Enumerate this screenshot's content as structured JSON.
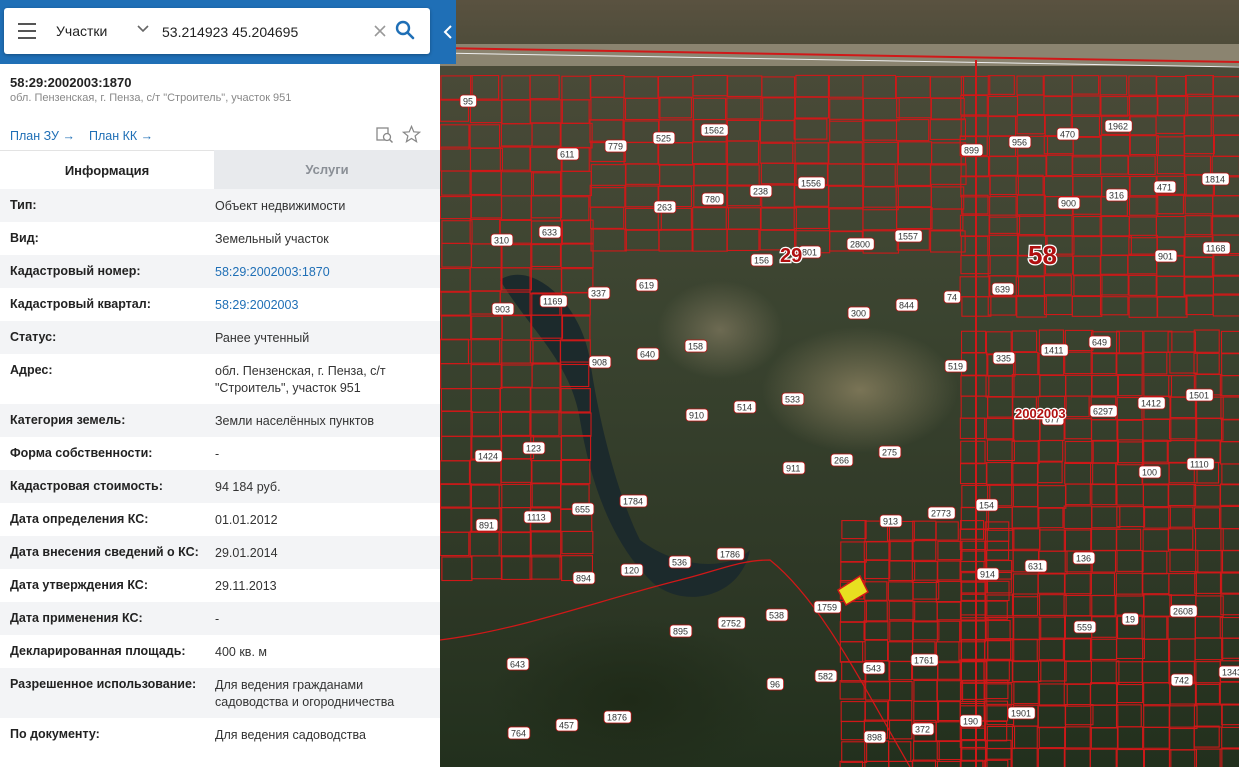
{
  "search": {
    "layer": "Участки",
    "query": "53.214923 45.204695"
  },
  "parcel": {
    "title": "58:29:2002003:1870",
    "address": "обл. Пензенская, г. Пенза, с/т \"Строитель\", участок 951"
  },
  "links": {
    "plan_zu": "План ЗУ",
    "plan_kk": "План КК"
  },
  "tabs": {
    "info": "Информация",
    "services": "Услуги"
  },
  "info": [
    {
      "key": "Тип:",
      "value": "Объект недвижимости"
    },
    {
      "key": "Вид:",
      "value": "Земельный участок"
    },
    {
      "key": "Кадастровый номер:",
      "value": "58:29:2002003:1870"
    },
    {
      "key": "Кадастровый квартал:",
      "value": "58:29:2002003"
    },
    {
      "key": "Статус:",
      "value": "Ранее учтенный"
    },
    {
      "key": "Адрес:",
      "value": "обл. Пензенская, г. Пенза, с/т \"Строитель\", участок 951"
    },
    {
      "key": "Категория земель:",
      "value": "Земли населённых пунктов"
    },
    {
      "key": "Форма собственности:",
      "value": "-"
    },
    {
      "key": "Кадастровая стоимость:",
      "value": "94 184 руб."
    },
    {
      "key": "Дата определения КС:",
      "value": "01.01.2012"
    },
    {
      "key": "Дата внесения сведений о КС:",
      "value": "29.01.2014"
    },
    {
      "key": "Дата утверждения КС:",
      "value": "29.11.2013"
    },
    {
      "key": "Дата применения КС:",
      "value": "-"
    },
    {
      "key": "Декларированная площадь:",
      "value": "400 кв. м"
    },
    {
      "key": "Разрешенное использование:",
      "value": "Для ведения гражданами садоводства и огородничества"
    },
    {
      "key": "По документу:",
      "value": "Для ведения садоводства"
    }
  ],
  "map": {
    "quarter_labels": [
      "29",
      "58",
      "2002003"
    ],
    "plot_labels": [
      "95",
      "611",
      "263",
      "156",
      "300",
      "519",
      "677",
      "100",
      "891",
      "894",
      "895",
      "96",
      "898",
      "899",
      "900",
      "901",
      "903",
      "908",
      "910",
      "911",
      "913",
      "914",
      "559",
      "742",
      "764",
      "779",
      "780",
      "801",
      "844",
      "335",
      "6297",
      "1110",
      "1113",
      "120",
      "2752",
      "582",
      "372",
      "956",
      "316",
      "1168",
      "1169",
      "640",
      "514",
      "266",
      "2773",
      "631",
      "19",
      "1343",
      "457",
      "525",
      "238",
      "2800",
      "74",
      "1411",
      "1412",
      "1424",
      "655",
      "536",
      "538",
      "543",
      "190",
      "470",
      "471",
      "310",
      "337",
      "158",
      "533",
      "275",
      "154",
      "136",
      "2608",
      "643",
      "1876",
      "1562",
      "1556",
      "1557",
      "639",
      "649",
      "1501",
      "123",
      "1784",
      "1786",
      "1759",
      "1761",
      "1901",
      "1962",
      "1814",
      "633",
      "619"
    ],
    "colors": {
      "boundary": "#d01818",
      "highlight": "#e8e020",
      "quarter_label": "#b01010"
    }
  }
}
